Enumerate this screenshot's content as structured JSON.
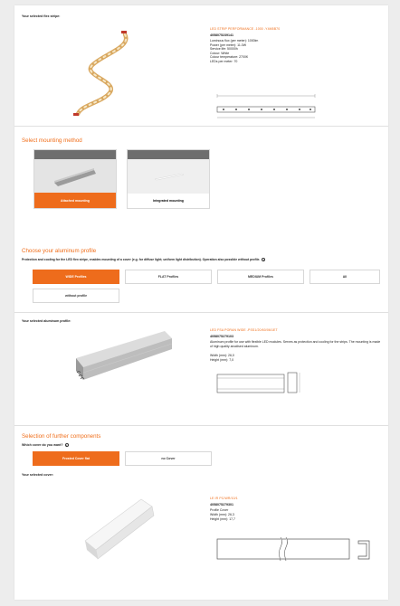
{
  "strip": {
    "section_label": "Your selected flex stripe:",
    "product_name": "LED STRIP PERFORMANCE -1000 -Y4M5B70",
    "article_number": "4058075239141",
    "specs": [
      "Luminous flux (per meter): 1000lm",
      "Power (per meter): 11.0W",
      "Service life: 50000h",
      "Colour: White",
      "Colour temperature: 2700K",
      "LEDs per meter: 70"
    ]
  },
  "mounting": {
    "title": "Select mounting method",
    "options": [
      {
        "label": "Attached mounting",
        "selected": true
      },
      {
        "label": "Integrated mounting",
        "selected": false
      }
    ]
  },
  "profile": {
    "title": "Choose your aluminum profile",
    "description": "Protection and cooling for the LED flex stripe, enables mounting of a cover (e.g. for diffuse light; uniform light distribution). Operation also possible without profile.",
    "options": [
      {
        "label": "WIDE Profiles",
        "selected": true
      },
      {
        "label": "FLAT Profiles",
        "selected": false
      },
      {
        "label": "MEDIUM Profiles",
        "selected": false
      },
      {
        "label": "All",
        "selected": false
      },
      {
        "label": "without profile",
        "selected": false
      }
    ]
  },
  "selected_profile": {
    "section_label": "Your selected aluminum profile:",
    "product_name": "LED FSA PORAN WIDE -PSS1/20/60/06/1ET",
    "article_number": "4058075279103",
    "description": "Aluminum profile for use with flexible LED modules. Serves as protection and cooling for the strips. The mounting is made of high quality anodised aluminum.",
    "specs": [
      "Width (mm): 26,0",
      "Height (mm): 7,0"
    ]
  },
  "components": {
    "title": "Selection of further components",
    "question": "Which cover do you want?",
    "options": [
      {
        "label": "Frosted Cover flat",
        "selected": true
      },
      {
        "label": "no Cover",
        "selected": false
      }
    ]
  },
  "selected_cover": {
    "section_label": "Your selected cover:",
    "product_name": "LE IR PC/WR/10/1",
    "article_number": "4058075279301",
    "type": "Profile Cover",
    "specs": [
      "Width (mm): 26,3",
      "Height (mm): 17,7"
    ]
  },
  "colors": {
    "accent": "#ee6c1c",
    "title": "#f06e1a"
  }
}
